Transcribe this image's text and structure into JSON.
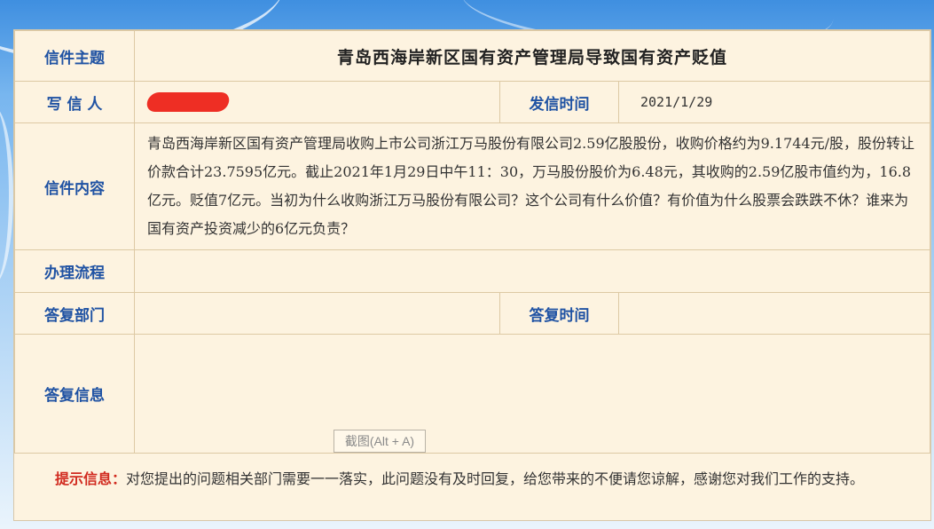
{
  "labels": {
    "subject": "信件主题",
    "writer": "写 信 人",
    "send_time": "发信时间",
    "content": "信件内容",
    "process": "办理流程",
    "reply_dept": "答复部门",
    "reply_time": "答复时间",
    "reply_info": "答复信息"
  },
  "letter": {
    "subject": "青岛西海岸新区国有资产管理局导致国有资产贬值",
    "writer_redacted": true,
    "send_time": "2021/1/29",
    "content": "青岛西海岸新区国有资产管理局收购上市公司浙江万马股份有限公司2.59亿股股份，收购价格约为9.1744元/股，股份转让价款合计23.7595亿元。截止2021年1月29日中午11：30，万马股份股价为6.48元，其收购的2.59亿股市值约为，16.8亿元。贬值7亿元。当初为什么收购浙江万马股份有限公司？这个公司有什么价值？有价值为什么股票会跌跌不休？谁来为国有资产投资减少的6亿元负责？",
    "process": "",
    "reply_dept": "",
    "reply_time": "",
    "reply_info": ""
  },
  "screenshot_button": "截图(Alt + A)",
  "tip": {
    "label": "提示信息：",
    "text": "对您提出的问题相关部门需要一一落实，此问题没有及时回复，给您带来的不便请您谅解，感谢您对我们工作的支持。"
  },
  "colors": {
    "label": "#1f52a3",
    "tip_label": "#d12a1f",
    "panel_bg": "#fdf3e0",
    "redaction": "#ee2e24"
  }
}
